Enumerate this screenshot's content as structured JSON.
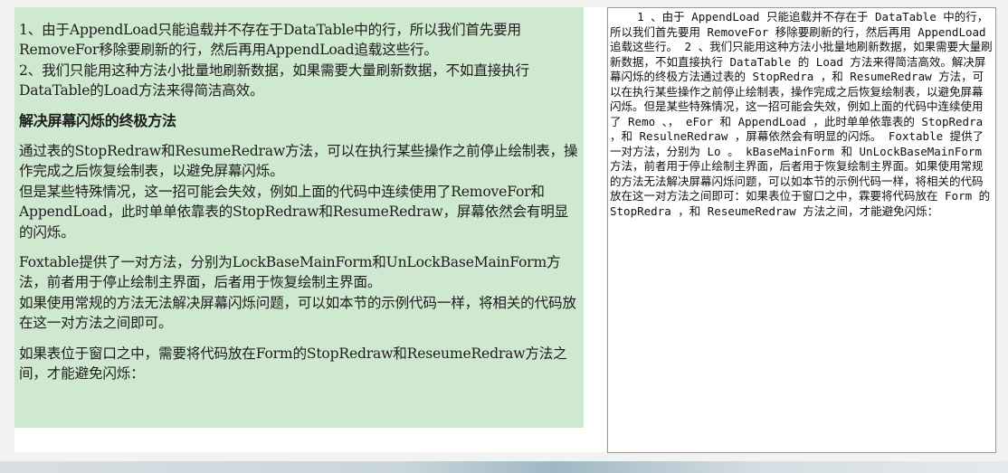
{
  "left_panel": {
    "paragraphs": [
      "1、由于AppendLoad只能追载并不存在于DataTable中的行，所以我们首先要用RemoveFor移除要刷新的行，然后再用AppendLoad追载这些行。",
      "2、我们只能用这种方法小批量地刷新数据，如果需要大量刷新数据，不如直接执行DataTable的Load方法来得简洁高效。",
      "解决屏幕闪烁的终极方法",
      "通过表的StopRedraw和ResumeRedraw方法，可以在执行某些操作之前停止绘制表，操作完成之后恢复绘制表，以避免屏幕闪烁。",
      "但是某些特殊情况，这一招可能会失效，例如上面的代码中连续使用了RemoveFor和AppendLoad，此时单单依靠表的StopRedraw和ResumeRedraw，屏幕依然会有明显的闪烁。",
      "Foxtable提供了一对方法，分别为LockBaseMainForm和UnLockBaseMainForm方法，前者用于停止绘制主界面，后者用于恢复绘制主界面。",
      "如果使用常规的方法无法解决屏幕闪烁问题，可以如本节的示例代码一样，将相关的代码放在这一对方法之间即可。",
      "如果表位于窗口之中，需要将代码放在Form的StopRedraw和ReseumeRedraw方法之间，才能避免闪烁："
    ]
  },
  "right_panel": {
    "ocr_text": "    1 、由于 AppendLoad 只能追载并不存在于 DataTable 中的行，所以我们首先要用 RemoveFor 移除要刷新的行，然后再用 AppendLoad 追载这些行。 2 、我们只能用这种方法小批量地刷新数据，如果需要大量刷新数据，不如直接执行 DataTable 的 Load 方法来得简洁高效。解决屏幕闪烁的终极方法通过表的 StopRedra ，和 ResumeRedraw 方法，可以在执行某些操作之前停止绘制表，操作完成之后恢复绘制表，以避免屏幕闪烁。但是某些特殊情况，这一招可能会失效，例如上面的代码中连续使用了 Remo 、， eFor 和 AppendLoad ，此时单单依靠表的 StopRedra ，和 ResulneRedraw ，屏幕依然会有明显的闪烁。 Foxtable 提供了一对方法，分别为 Lo 。 kBaseMainForm 和 UnLockBaseMainForm 方法，前者用于停止绘制主界面，后者用于恢复绘制主界面。如果使用常规的方法无法解决屏幕闪烁问题，可以如本节的示例代码一样，将相关的代码放在这一对方法之间即可：如果表位于窗口之中，霖要将代码放在 Form 的 StopRedra ，和 ReseumeRedraw 方法之间，才能避免闪烁："
  }
}
